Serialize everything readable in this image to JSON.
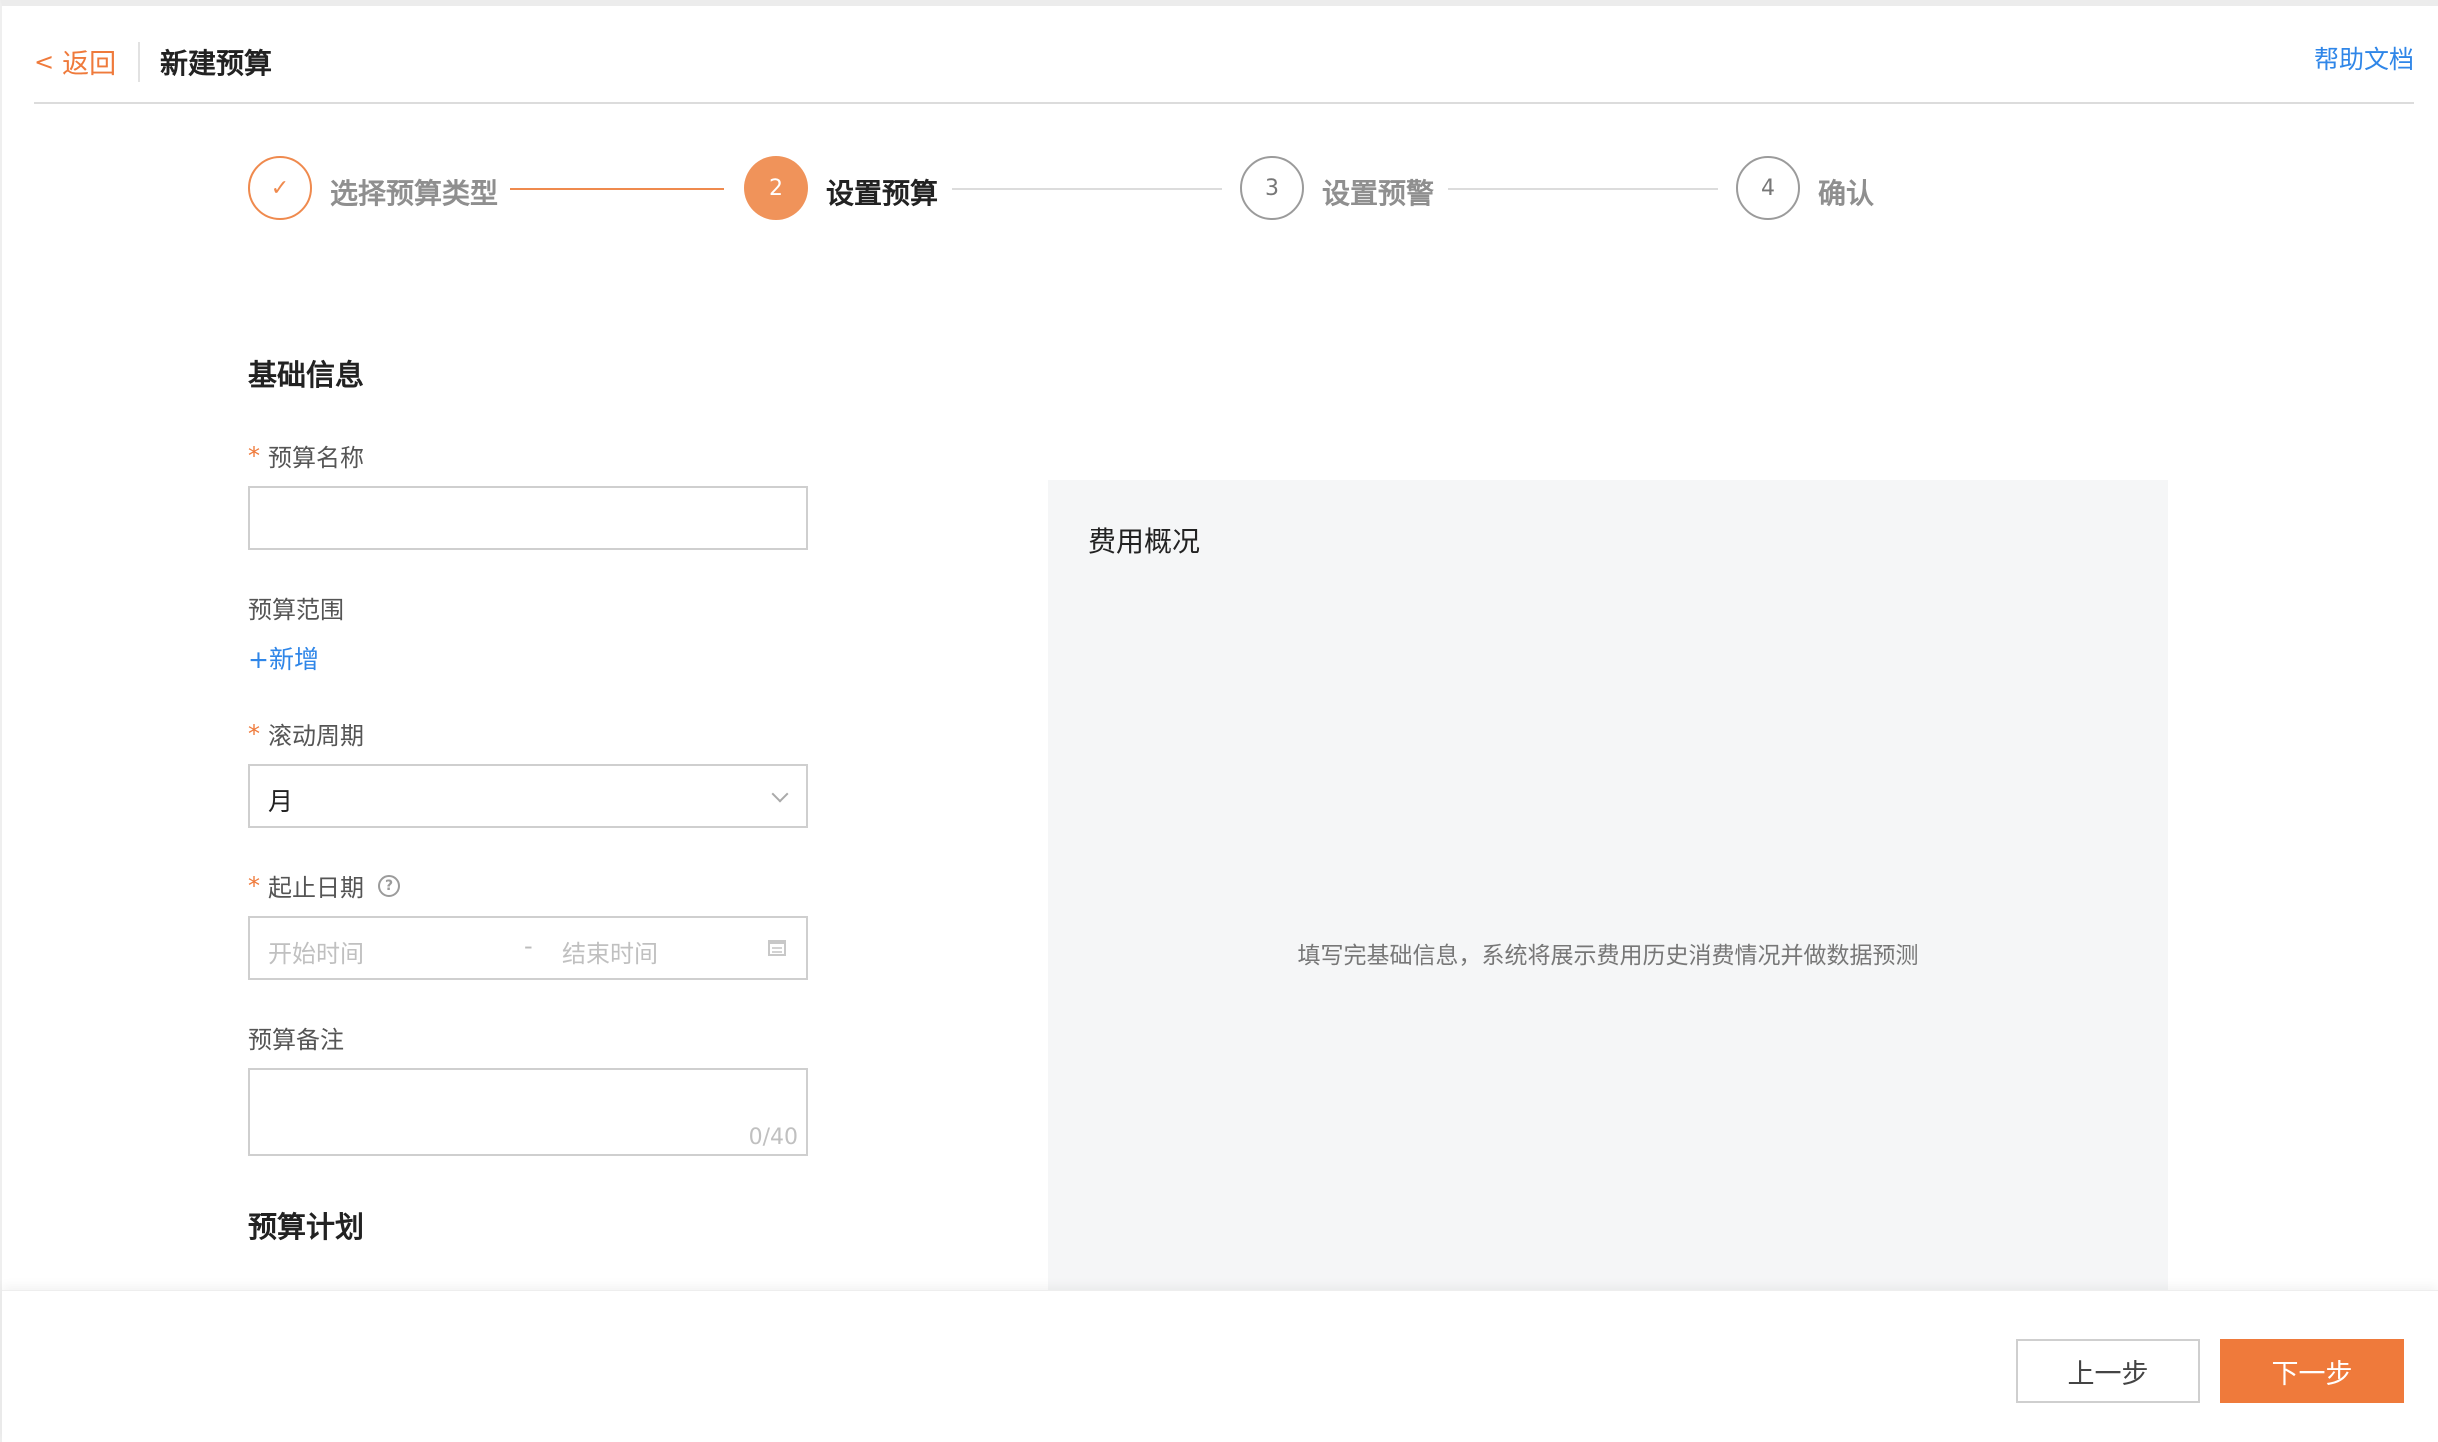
{
  "header": {
    "back_label": "返回",
    "title": "新建预算",
    "help_label": "帮助文档"
  },
  "steps": [
    {
      "number": "1",
      "label": "选择预算类型",
      "status": "done"
    },
    {
      "number": "2",
      "label": "设置预算",
      "status": "active"
    },
    {
      "number": "3",
      "label": "设置预警",
      "status": "pending"
    },
    {
      "number": "4",
      "label": "确认",
      "status": "pending"
    }
  ],
  "form": {
    "section_basic": "基础信息",
    "budget_name": {
      "label": "预算名称",
      "required": true,
      "value": "",
      "placeholder": ""
    },
    "budget_scope": {
      "label": "预算范围",
      "add_label": "+新增"
    },
    "rolling_period": {
      "label": "滚动周期",
      "required": true,
      "value": "月"
    },
    "date_range": {
      "label": "起止日期",
      "required": true,
      "start_placeholder": "开始时间",
      "separator": "-",
      "end_placeholder": "结束时间"
    },
    "budget_note": {
      "label": "预算备注",
      "value": "",
      "counter": "0/40"
    },
    "section_plan": "预算计划"
  },
  "overview": {
    "title": "费用概况",
    "hint": "填写完基础信息，系统将展示费用历史消费情况并做数据预测"
  },
  "footer": {
    "prev_label": "上一步",
    "next_label": "下一步"
  },
  "colors": {
    "accent": "#ef7a3b",
    "link": "#2f86e8",
    "panel_bg": "#f5f6f7"
  }
}
